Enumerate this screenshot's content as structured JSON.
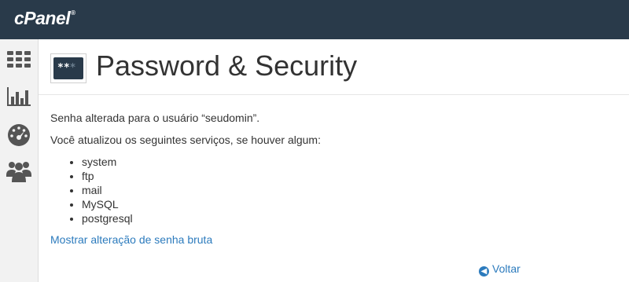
{
  "brand": {
    "logo_text": "cPanel",
    "trademark": "®"
  },
  "sidebar": {
    "items": [
      {
        "icon": "grid-icon",
        "label": ""
      },
      {
        "icon": "bar-chart-icon",
        "label": ""
      },
      {
        "icon": "dashboard-gauge-icon",
        "label": ""
      },
      {
        "icon": "users-icon",
        "label": ""
      }
    ]
  },
  "header": {
    "title": "Password & Security",
    "icon": "password-icon",
    "icon_text": "**",
    "icon_text_dim": "*"
  },
  "content": {
    "message1": "Senha alterada para o usuário “seudomin”.",
    "message2": "Você atualizou os seguintes serviços, se houver algum:",
    "services": [
      "system",
      "ftp",
      "mail",
      "MySQL",
      "postgresql"
    ],
    "raw_link": "Mostrar alteração de senha bruta",
    "back_label": "Voltar"
  },
  "colors": {
    "topbar": "#293a4a",
    "link": "#2c7bbd",
    "sidebar": "#f2f2f2",
    "text": "#333333"
  }
}
